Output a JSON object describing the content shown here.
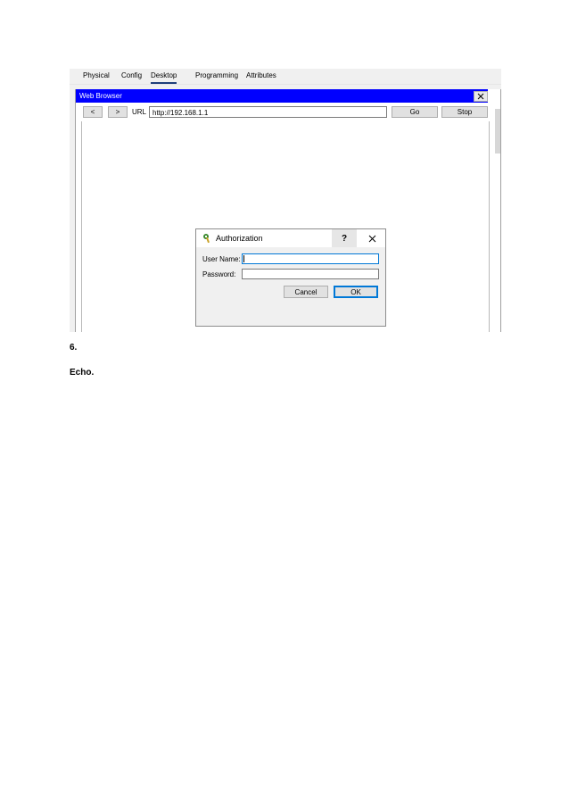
{
  "tabs": [
    {
      "label": "Physical",
      "active": false
    },
    {
      "label": "Config",
      "active": false
    },
    {
      "label": "Desktop",
      "active": true
    },
    {
      "label": "Programming",
      "active": false
    },
    {
      "label": "Attributes",
      "active": false
    }
  ],
  "browser": {
    "title": "Web Browser",
    "close_icon": "close-icon",
    "back_label": "<",
    "forward_label": ">",
    "url_label": "URL",
    "url_value": "http://192.168.1.1",
    "go_label": "Go",
    "stop_label": "Stop",
    "title_color": "#0000ff"
  },
  "auth_dialog": {
    "title": "Authorization",
    "icon": "key-icon",
    "help_label": "?",
    "user_name_label": "User Name:",
    "user_name_value": "",
    "password_label": "Password:",
    "password_value": "",
    "cancel_label": "Cancel",
    "ok_label": "OK"
  },
  "document": {
    "step_number": "6.",
    "heading": "Echo."
  }
}
